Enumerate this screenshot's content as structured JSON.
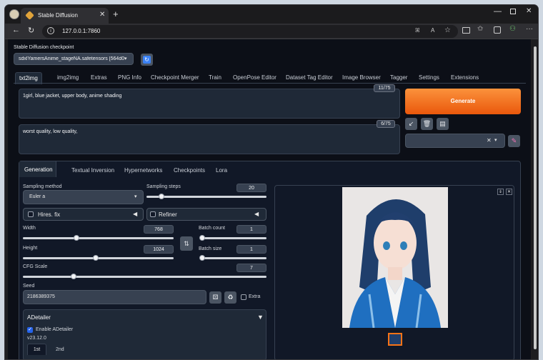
{
  "browser": {
    "tab_title": "Stable Diffusion",
    "new_tab": "+",
    "url": "127.0.0.1:7860",
    "window_controls": [
      "minimize-icon",
      "maximize-icon",
      "close-icon"
    ],
    "toolbar_icons": [
      "read-aloud-icon",
      "text-size-icon",
      "favorites-star-icon",
      "split-screen-icon",
      "favorites-icon",
      "collections-icon",
      "extensions-icon",
      "more-icon"
    ],
    "toolbar_labels": {
      "read": "ꕤ",
      "text": "A"
    }
  },
  "checkpoint": {
    "label": "Stable Diffusion checkpoint",
    "value": "sdxlYamersAnime_stageNA.safetensors [564d0b"
  },
  "main_tabs": [
    "txt2img",
    "img2img",
    "Extras",
    "PNG Info",
    "Checkpoint Merger",
    "Train",
    "OpenPose Editor",
    "Dataset Tag Editor",
    "Image Browser",
    "Tagger",
    "Settings",
    "Extensions"
  ],
  "prompt": {
    "text": "1girl, blue jacket, upper body, anime shading",
    "counter": "11/75"
  },
  "negative": {
    "text": "worst quality, low quality,",
    "counter": "6/75"
  },
  "generate_label": "Generate",
  "sub_tabs": [
    "Generation",
    "Textual Inversion",
    "Hypernetworks",
    "Checkpoints",
    "Lora"
  ],
  "sampling": {
    "method_label": "Sampling method",
    "method_value": "Euler a",
    "steps_label": "Sampling steps",
    "steps": 20,
    "steps_max": 150
  },
  "hires": {
    "label": "Hires. fix"
  },
  "refiner": {
    "label": "Refiner"
  },
  "width": {
    "label": "Width",
    "value": 768,
    "max": 2048
  },
  "height": {
    "label": "Height",
    "value": 1024,
    "max": 2048
  },
  "batch_count": {
    "label": "Batch count",
    "value": 1
  },
  "batch_size": {
    "label": "Batch size",
    "value": 1
  },
  "cfg": {
    "label": "CFG Scale",
    "value": 7,
    "max": 30
  },
  "seed": {
    "label": "Seed",
    "value": "2186389375",
    "extra": "Extra"
  },
  "adetailer": {
    "title": "ADetailer",
    "enable": "Enable ADetailer",
    "version": "v23.12.0",
    "tabs": [
      "1st",
      "2nd"
    ]
  },
  "colors": {
    "accent": "#f97316",
    "panel": "#1f2937",
    "page": "#0c0f17",
    "checkbox": "#2563eb"
  }
}
